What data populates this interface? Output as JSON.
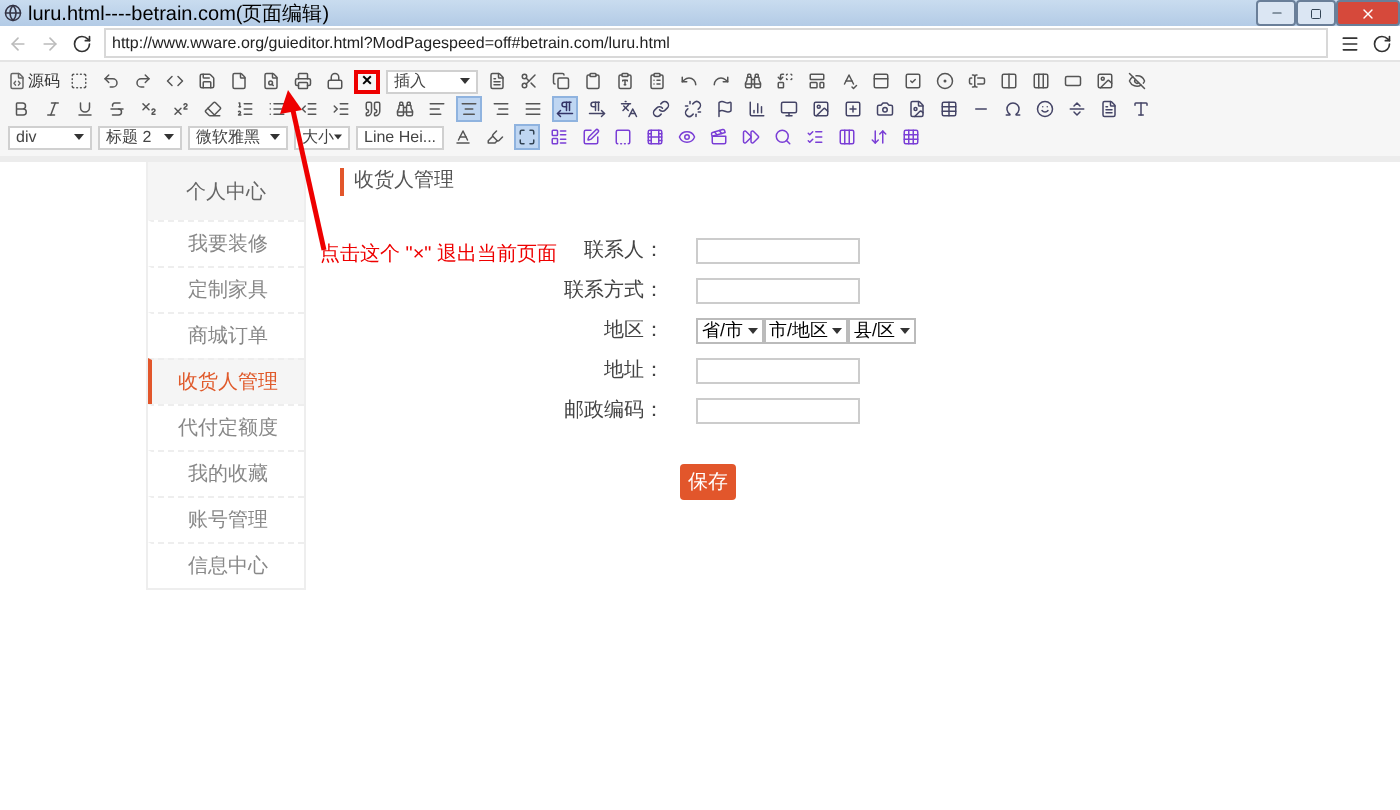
{
  "window": {
    "title": "luru.html----betrain.com(页面编辑)"
  },
  "address_bar": {
    "url": "http://www.wware.org/guieditor.html?ModPagespeed=off#betrain.com/luru.html"
  },
  "editor_toolbar": {
    "source_label": "源码",
    "close_label": "×",
    "insert_select": "插入",
    "format_select": "div",
    "heading_select": "标题 2",
    "font_select": "微软雅黑",
    "size_select": "大小",
    "line_height_select": "Line Hei...",
    "align_center_on": true,
    "show_blocks_on": true,
    "maximize_on": true
  },
  "sidebar": {
    "title": "个人中心",
    "items": [
      {
        "label": "我要装修",
        "selected": false
      },
      {
        "label": "定制家具",
        "selected": false
      },
      {
        "label": "商城订单",
        "selected": false
      },
      {
        "label": "收货人管理",
        "selected": true
      },
      {
        "label": "代付定额度",
        "selected": false
      },
      {
        "label": "我的收藏",
        "selected": false
      },
      {
        "label": "账号管理",
        "selected": false
      },
      {
        "label": "信息中心",
        "selected": false
      }
    ]
  },
  "page_title": "收货人管理",
  "annotation": {
    "text": "点击这个 \"×\" 退出当前页面"
  },
  "form": {
    "fields": [
      {
        "kind": "text",
        "label": "联系人："
      },
      {
        "kind": "text",
        "label": "联系方式："
      },
      {
        "kind": "region",
        "label": "地区：",
        "selects": [
          "省/市",
          "市/地区",
          "县/区"
        ]
      },
      {
        "kind": "text",
        "label": "地址："
      },
      {
        "kind": "text",
        "label": "邮政编码："
      }
    ],
    "submit": "保存"
  }
}
